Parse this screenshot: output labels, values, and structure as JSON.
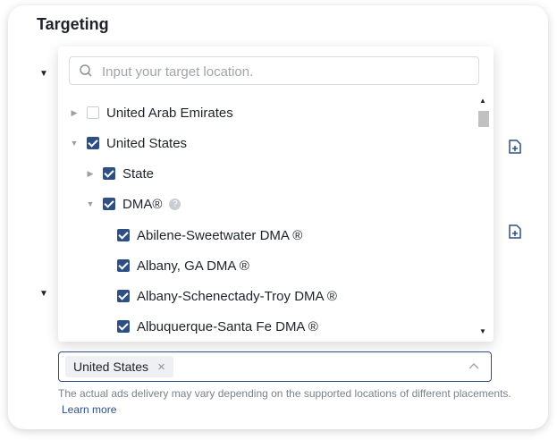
{
  "section": {
    "title": "Targeting"
  },
  "search": {
    "placeholder": "Input your target location."
  },
  "tree": {
    "items": [
      {
        "label": "United Arab Emirates",
        "checked": false,
        "expanded": false
      },
      {
        "label": "United States",
        "checked": true,
        "expanded": true
      },
      {
        "label": "State",
        "checked": true,
        "expanded": false
      },
      {
        "label": "DMA®",
        "checked": true,
        "expanded": true
      },
      {
        "label": "Abilene-Sweetwater DMA ®",
        "checked": true
      },
      {
        "label": "Albany, GA DMA ®",
        "checked": true
      },
      {
        "label": "Albany-Schenectady-Troy DMA ®",
        "checked": true
      },
      {
        "label": "Albuquerque-Santa Fe DMA ®",
        "checked": true
      }
    ]
  },
  "selection": {
    "tag": "United States",
    "tag_remove": "×"
  },
  "footer": {
    "note": "The actual ads delivery may vary depending on the supported locations of different placements.",
    "link": "Learn more"
  },
  "colors": {
    "accent": "#2e4f86",
    "border": "#d9dce1",
    "muted": "#7c8189"
  },
  "icons": [
    "search-icon",
    "file-add-icon",
    "help-icon",
    "close-icon",
    "chevron-up-icon",
    "triangle-down-icon",
    "triangle-right-icon"
  ]
}
